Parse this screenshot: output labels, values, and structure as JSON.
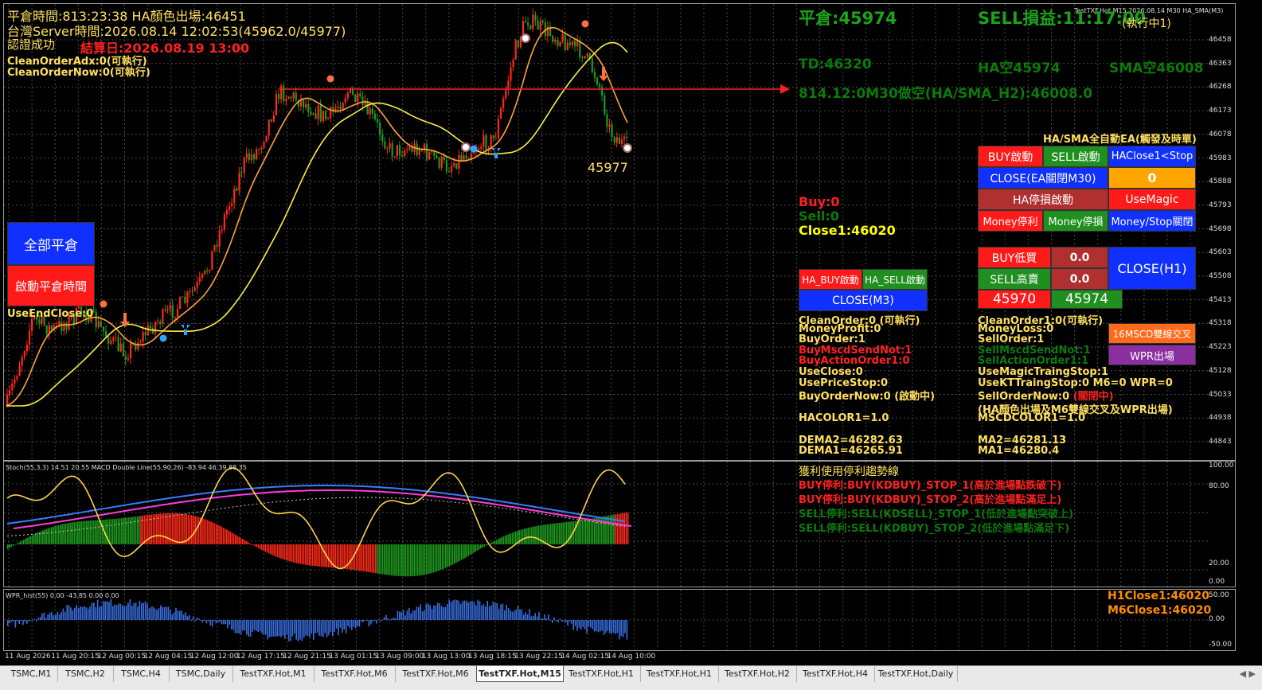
{
  "header": {
    "line1": "平倉時間:813:23:38 HA顏色出場:46451",
    "server_time": "台灣Server時間:2026.08.14 12:02:53(45962.0/45977)",
    "auth": "認證成功",
    "expire": "結算日:2026.08.19 13:00",
    "clean_adx": "CleanOrderAdx:0(可執行)",
    "clean_now": "CleanOrderNow:0(可執行)",
    "symbol_title": "TestTXF.Hot,M15 2026.08.14 M30 HA_SMA(M3)"
  },
  "left_panel": {
    "close_all": "全部平倉",
    "enable_close_time": "啟動平倉時間",
    "use_end_close": "UseEndClose:0"
  },
  "chart_labels": {
    "last_price": "45977"
  },
  "status": {
    "flat": "平倉:45974",
    "sell_pnl": "SELL損益:11:17:00",
    "running": "(執行中1)",
    "td": "TD:46320",
    "ha_short": "HA空45974",
    "sma_short": "SMA空46008",
    "signal_line": "814.12:0M30做空(HA/SMA_H2):46008.0",
    "ea_title": "HA/SMA全自動EA(觸發及時單)",
    "buy_count": "Buy:0",
    "sell_count": "Sell:0",
    "close1": "Close1:46020"
  },
  "buttons": {
    "buy_start": "BUY啟動",
    "sell_start": "SELL啟動",
    "ha_close_stop": "HAClose1<Stop",
    "close_ea": "CLOSE(EA關閉M30)",
    "zero_box": "0",
    "ha_stop_start": "HA停損啟動",
    "use_magic": "UseMagic",
    "money_profit": "Money停利",
    "money_stop": "Money停損",
    "money_stop_close": "Money/Stop關閉",
    "ha_buy_start": "HA_BUY啟動",
    "ha_sell_start": "HA_SELL啟動",
    "close_m3": "CLOSE(M3)",
    "buy_low": "BUY低買",
    "buy_low_val": "0.0",
    "sell_high": "SELL高賣",
    "sell_high_val": "0.0",
    "close_h1": "CLOSE(H1)",
    "price_a": "45970",
    "price_b": "45974",
    "macd_cross": "16MSCD雙線交叉",
    "wpr_exit": "WPR出場"
  },
  "info_left": {
    "l1": "CleanOrder:0 (可執行)",
    "l2": "MoneyProfit:0",
    "l3": "BuyOrder:1",
    "l4": "BuyMscdSendNot:1",
    "l5": "BuyActionOrder1:0",
    "l6": "UseClose:0",
    "l7": "UsePriceStop:0",
    "l8": "BuyOrderNow:0 (啟動中)",
    "l9": "HACOLOR1=1.0",
    "l10": "DEMA2=46282.63",
    "l11": "DEMA1=46265.91"
  },
  "info_right": {
    "r1": "CleanOrder1:0(可執行)",
    "r2": "MoneyLoss:0",
    "r3": "SellOrder:1",
    "r4": "SellMscdSendNot:1",
    "r5": "SellActionOrder1:1",
    "r6": "UseMagicTraingStop:1",
    "r7": "UseKTTraingStop:0  M6=0  WPR=0",
    "r8": "SellOrderNow:0",
    "r8b": "(關閉中)",
    "r9": "(HA顏色出場及M6雙線交叉及WPR出場)",
    "r10": "MSCDCOLOR1=1.0",
    "r11": "MA2=46281.13",
    "r12": "MA1=46280.4"
  },
  "trend": {
    "title": "獲利使用停利趨勢線",
    "t1": "BUY停利:BUY(KDBUY)_STOP_1(高於進場點跌破下)",
    "t2": "BUY停利:BUY(KDBUY)_STOP_2(高於進場點滿足上)",
    "t3": "SELL停利:SELL(KDSELL)_STOP_1(低於進場點突破上)",
    "t4": "SELL停利:SELL(KDBUY)_STOP_2(低於進場點滿足下)"
  },
  "stoch_panel": {
    "label": "Stoch(55,3,3) 14.51 20.55 MACD Double Line(55,90,26) -83.94 46.39 88.35",
    "axis": [
      "100.00",
      "80.00",
      "20.00",
      "0.00"
    ]
  },
  "wpr_panel": {
    "label": "WPR_hist(55) 0.00 -43.85 0.00 0.00",
    "h1close": "H1Close1:46020",
    "m6close": "M6Close1:46020",
    "axis": [
      "50.00",
      "0.00",
      "-50.00"
    ]
  },
  "price_axis": [
    "46458",
    "46363",
    "46268",
    "46173",
    "46078",
    "45983",
    "45888",
    "45793",
    "45698",
    "45603",
    "45508",
    "45413",
    "45318",
    "45223",
    "45128",
    "45033",
    "44938",
    "44843"
  ],
  "time_axis": [
    "11 Aug 2026",
    "11 Aug 20:15",
    "12 Aug 00:15",
    "12 Aug 04:15",
    "12 Aug 12:00",
    "12 Aug 17:15",
    "12 Aug 21:15",
    "13 Aug 01:15",
    "13 Aug 09:00",
    "13 Aug 13:00",
    "13 Aug 18:15",
    "13 Aug 22:15",
    "14 Aug 02:15",
    "14 Aug 10:00"
  ],
  "tabs": [
    "TSMC,M1",
    "TSMC,H2",
    "TSMC,H4",
    "TSMC,Daily",
    "TestTXF.Hot,M1",
    "TestTXF.Hot,M6",
    "TestTXF.Hot,M6",
    "TestTXF.Hot,M15",
    "TestTXF.Hot,H1",
    "TestTXF.Hot,H1",
    "TestTXF.Hot,H2",
    "TestTXF.Hot,H4",
    "TestTXF.Hot,Daily"
  ],
  "active_tab": 7,
  "colors": {
    "bull": "#ff2a1a",
    "bear": "#1e9b1e",
    "ma_fast": "#ffa43a",
    "ma_slow": "#ffee44",
    "macd_blue": "#3a7bff",
    "macd_pink": "#ff3cdc",
    "stoch": "#ffd24a",
    "wpr": "#3a6fe0",
    "grid": "#4a4a4a"
  }
}
